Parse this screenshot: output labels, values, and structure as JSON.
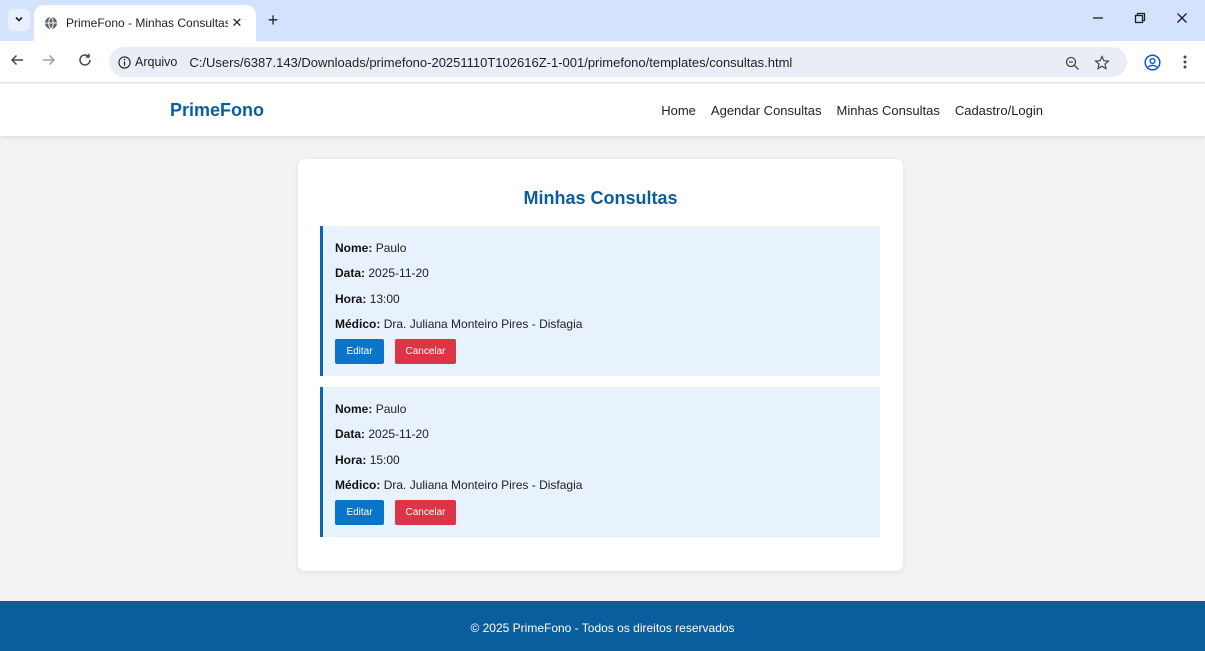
{
  "browser": {
    "tab_title": "PrimeFono - Minhas Consultas",
    "tab_close": "✕",
    "new_tab": "+",
    "info_label": "Arquivo",
    "url": "C:/Users/6387.143/Downloads/primefono-20251110T102616Z-1-001/primefono/templates/consultas.html"
  },
  "site": {
    "brand": "PrimeFono",
    "nav": [
      "Home",
      "Agendar Consultas",
      "Minhas Consultas",
      "Cadastro/Login"
    ]
  },
  "page": {
    "title": "Minhas Consultas",
    "labels": {
      "nome": "Nome:",
      "data": "Data:",
      "hora": "Hora:",
      "medico": "Médico:"
    },
    "buttons": {
      "edit": "Editar",
      "cancel": "Cancelar"
    },
    "appointments": [
      {
        "nome": "Paulo",
        "data": "2025-11-20",
        "hora": "13:00",
        "medico": "Dra. Juliana Monteiro Pires - Disfagia"
      },
      {
        "nome": "Paulo",
        "data": "2025-11-20",
        "hora": "15:00",
        "medico": "Dra. Juliana Monteiro Pires - Disfagia"
      }
    ]
  },
  "footer": {
    "text": "© 2025 PrimeFono - Todos os direitos reservados"
  },
  "colors": {
    "brand": "#0b5e9e",
    "edit_button": "#0a74c8",
    "cancel_button": "#dc3545",
    "appointment_bg": "#e7f2fd"
  }
}
